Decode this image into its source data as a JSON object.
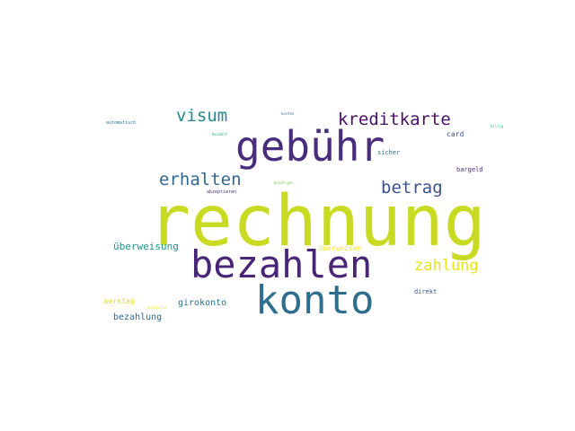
{
  "word_cloud": {
    "words": [
      {
        "text": "rechnung",
        "color": "#c8db22"
      },
      {
        "text": "gebühr",
        "color": "#472d7b"
      },
      {
        "text": "bezahlen",
        "color": "#482576"
      },
      {
        "text": "konto",
        "color": "#2f6e8e"
      },
      {
        "text": "kreditkarte",
        "color": "#471164"
      },
      {
        "text": "visum",
        "color": "#23898e"
      },
      {
        "text": "erhalten",
        "color": "#31688e"
      },
      {
        "text": "betrag",
        "color": "#3b528b"
      },
      {
        "text": "zahlung",
        "color": "#e5e419"
      },
      {
        "text": "überweisung",
        "color": "#21918c"
      },
      {
        "text": "bezahlung",
        "color": "#31688e"
      },
      {
        "text": "girokonto",
        "color": "#2c728e"
      },
      {
        "text": "werktag",
        "color": "#e0dd22"
      },
      {
        "text": "card",
        "color": "#3e4989"
      },
      {
        "text": "bargeld",
        "color": "#472d7b"
      },
      {
        "text": "direkt",
        "color": "#3b528b"
      },
      {
        "text": "sicher",
        "color": "#2c728e"
      },
      {
        "text": "überweisen",
        "color": "#fde725"
      },
      {
        "text": "automatisch",
        "color": "#2a788e"
      },
      {
        "text": "bezahlt",
        "color": "#22a884"
      },
      {
        "text": "akzeptieren",
        "color": "#46327e"
      },
      {
        "text": "benötigen",
        "color": "#7ad151"
      },
      {
        "text": "kosten",
        "color": "#2c728e"
      },
      {
        "text": "billig",
        "color": "#44bf70"
      },
      {
        "text": "kontrolle",
        "color": "#e5e419"
      }
    ]
  }
}
